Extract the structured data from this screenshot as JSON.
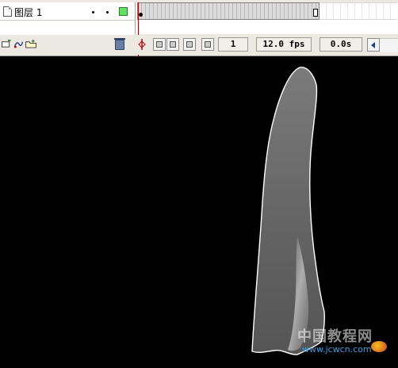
{
  "timeline": {
    "layer": {
      "name": "图层 1",
      "icon": "layer-page-icon",
      "outline_color": "#5fe05f"
    },
    "toolbar": {
      "icons": [
        "add-layer-icon",
        "add-motion-guide-icon",
        "insert-layer-folder-icon",
        "delete-layer-icon"
      ],
      "frame_buttons": [
        "center-frame-icon",
        "onion-skin-icon",
        "onion-skin-outlines-icon",
        "edit-multiple-frames-icon",
        "modify-onion-markers-icon"
      ],
      "current_frame": "1",
      "frame_rate": "12.0 fps",
      "elapsed_time": "0.0s"
    },
    "playhead_color": "#c00000"
  },
  "stage": {
    "background": "#000000",
    "shape_fill": "#6b6b6b",
    "shape_stroke": "#ffffff"
  },
  "watermark": {
    "title": "中国教程网",
    "url": "www.jcwcn.com"
  }
}
